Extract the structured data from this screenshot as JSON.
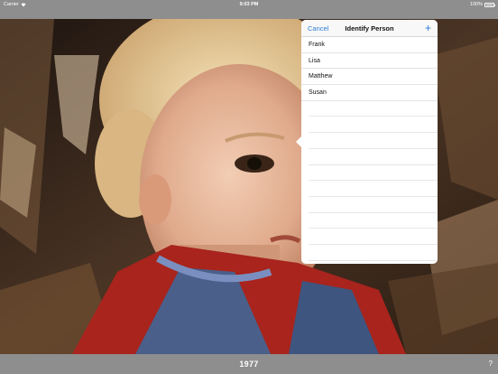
{
  "status_bar": {
    "carrier": "Carrier",
    "time": "9:03 PM",
    "battery": "100%",
    "icons": [
      "wifi-icon",
      "battery-icon"
    ]
  },
  "popover": {
    "cancel_label": "Cancel",
    "title": "Identify Person",
    "add_label": "+",
    "people": [
      "Frank",
      "Lisa",
      "Matthew",
      "Susan"
    ],
    "accent_color": "#2a7fd4"
  },
  "toolbar": {
    "year": "1977",
    "help_label": "?"
  }
}
